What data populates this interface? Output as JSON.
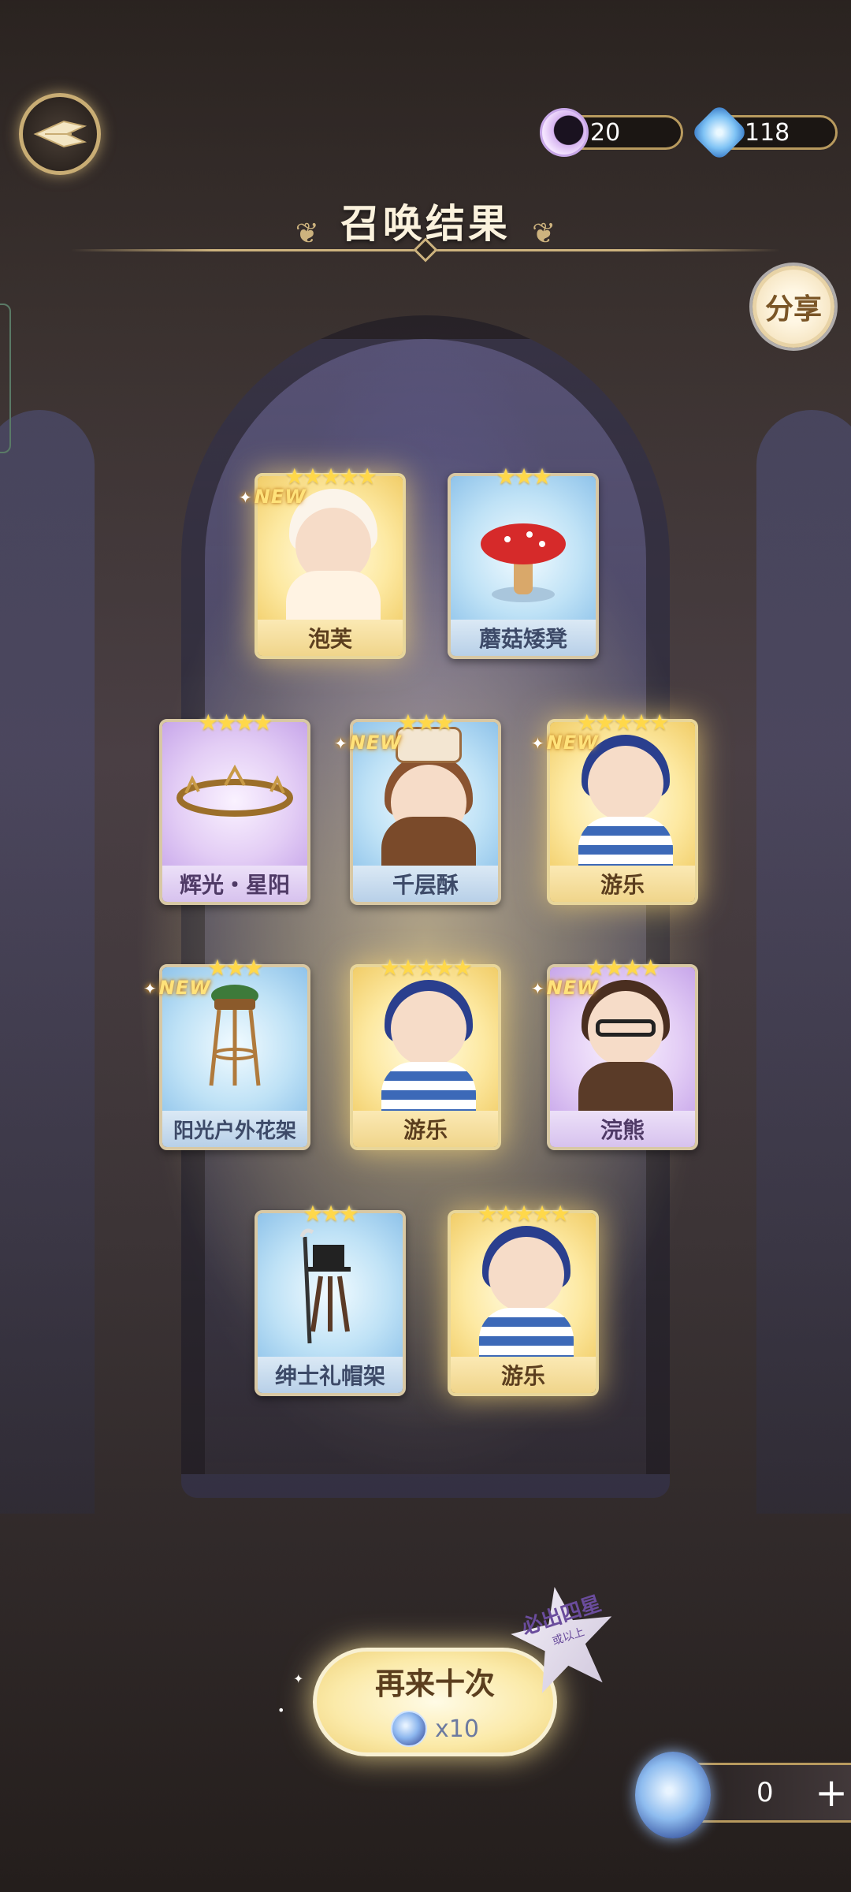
{
  "header": {
    "title": "召唤结果",
    "moon_currency": "20",
    "gem_currency": "118",
    "share_label": "分享"
  },
  "cards": [
    {
      "name": "泡芙",
      "stars": "★★★★★",
      "new": "NEW",
      "rarity": "gold"
    },
    {
      "name": "蘑菇矮凳",
      "stars": "★★★",
      "new": "",
      "rarity": "blue"
    },
    {
      "name": "辉光・星阳",
      "stars": "★★★★",
      "new": "",
      "rarity": "purple"
    },
    {
      "name": "千层酥",
      "stars": "★★★",
      "new": "NEW",
      "rarity": "blue"
    },
    {
      "name": "游乐",
      "stars": "★★★★★",
      "new": "NEW",
      "rarity": "gold"
    },
    {
      "name": "阳光户外花架",
      "stars": "★★★",
      "new": "NEW",
      "rarity": "blue"
    },
    {
      "name": "游乐",
      "stars": "★★★★★",
      "new": "",
      "rarity": "gold"
    },
    {
      "name": "浣熊",
      "stars": "★★★★",
      "new": "NEW",
      "rarity": "purple"
    },
    {
      "name": "绅士礼帽架",
      "stars": "★★★",
      "new": "",
      "rarity": "blue"
    },
    {
      "name": "游乐",
      "stars": "★★★★★",
      "new": "",
      "rarity": "gold"
    }
  ],
  "bottom": {
    "retry_label": "再来十次",
    "retry_cost": "x10",
    "guarantee_main": "必出四星",
    "guarantee_sub": "或以上",
    "balance": "0",
    "plus": "+"
  }
}
